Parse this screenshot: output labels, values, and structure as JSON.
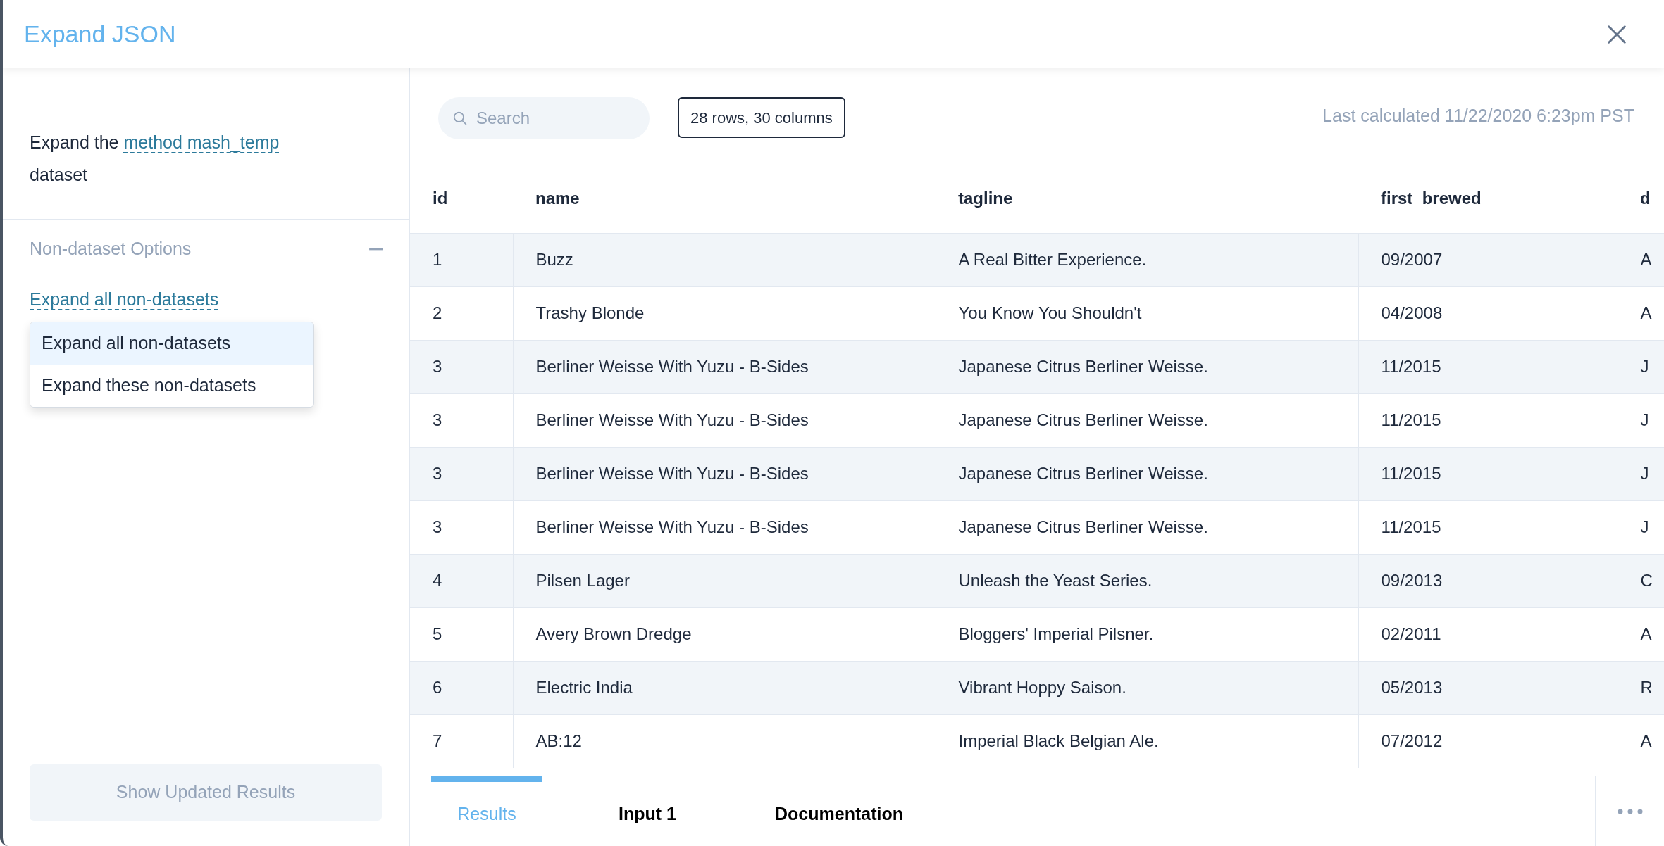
{
  "dialog": {
    "title": "Expand JSON"
  },
  "left_panel": {
    "description": {
      "before": "Expand the",
      "link": "method mash_temp",
      "after": "dataset"
    },
    "options_section": {
      "title": "Non-dataset Options",
      "expanded": true,
      "mode_link": "Expand all non-datasets",
      "menu": [
        {
          "label": "Expand all non-datasets",
          "selected": true
        },
        {
          "label": "Expand these non-datasets",
          "selected": false
        }
      ]
    },
    "apply_button": {
      "label": "Show Updated Results",
      "disabled": true
    }
  },
  "toolbar": {
    "search": {
      "placeholder": "Search"
    },
    "row_count": "28 rows, 30 columns",
    "last_calculated": "Last calculated 11/22/2020 6:23pm PST"
  },
  "table": {
    "columns": [
      "id",
      "name",
      "tagline",
      "first_brewed",
      "d"
    ],
    "rows": [
      [
        "1",
        "Buzz",
        "A Real Bitter Experience.",
        "09/2007",
        "A"
      ],
      [
        "2",
        "Trashy Blonde",
        "You Know You Shouldn't",
        "04/2008",
        "A"
      ],
      [
        "3",
        "Berliner Weisse With Yuzu - B-Sides",
        "Japanese Citrus Berliner Weisse.",
        "11/2015",
        "J"
      ],
      [
        "3",
        "Berliner Weisse With Yuzu - B-Sides",
        "Japanese Citrus Berliner Weisse.",
        "11/2015",
        "J"
      ],
      [
        "3",
        "Berliner Weisse With Yuzu - B-Sides",
        "Japanese Citrus Berliner Weisse.",
        "11/2015",
        "J"
      ],
      [
        "3",
        "Berliner Weisse With Yuzu - B-Sides",
        "Japanese Citrus Berliner Weisse.",
        "11/2015",
        "J"
      ],
      [
        "4",
        "Pilsen Lager",
        "Unleash the Yeast Series.",
        "09/2013",
        "C"
      ],
      [
        "5",
        "Avery Brown Dredge",
        "Bloggers' Imperial Pilsner.",
        "02/2011",
        "A"
      ],
      [
        "6",
        "Electric India",
        "Vibrant Hoppy Saison.",
        "05/2013",
        "R"
      ],
      [
        "7",
        "AB:12",
        "Imperial Black Belgian Ale.",
        "07/2012",
        "A"
      ]
    ]
  },
  "bottom_tabs": [
    {
      "label": "Results",
      "selected": true
    },
    {
      "label": "Input 1",
      "selected": false
    },
    {
      "label": "Documentation",
      "selected": false
    }
  ]
}
